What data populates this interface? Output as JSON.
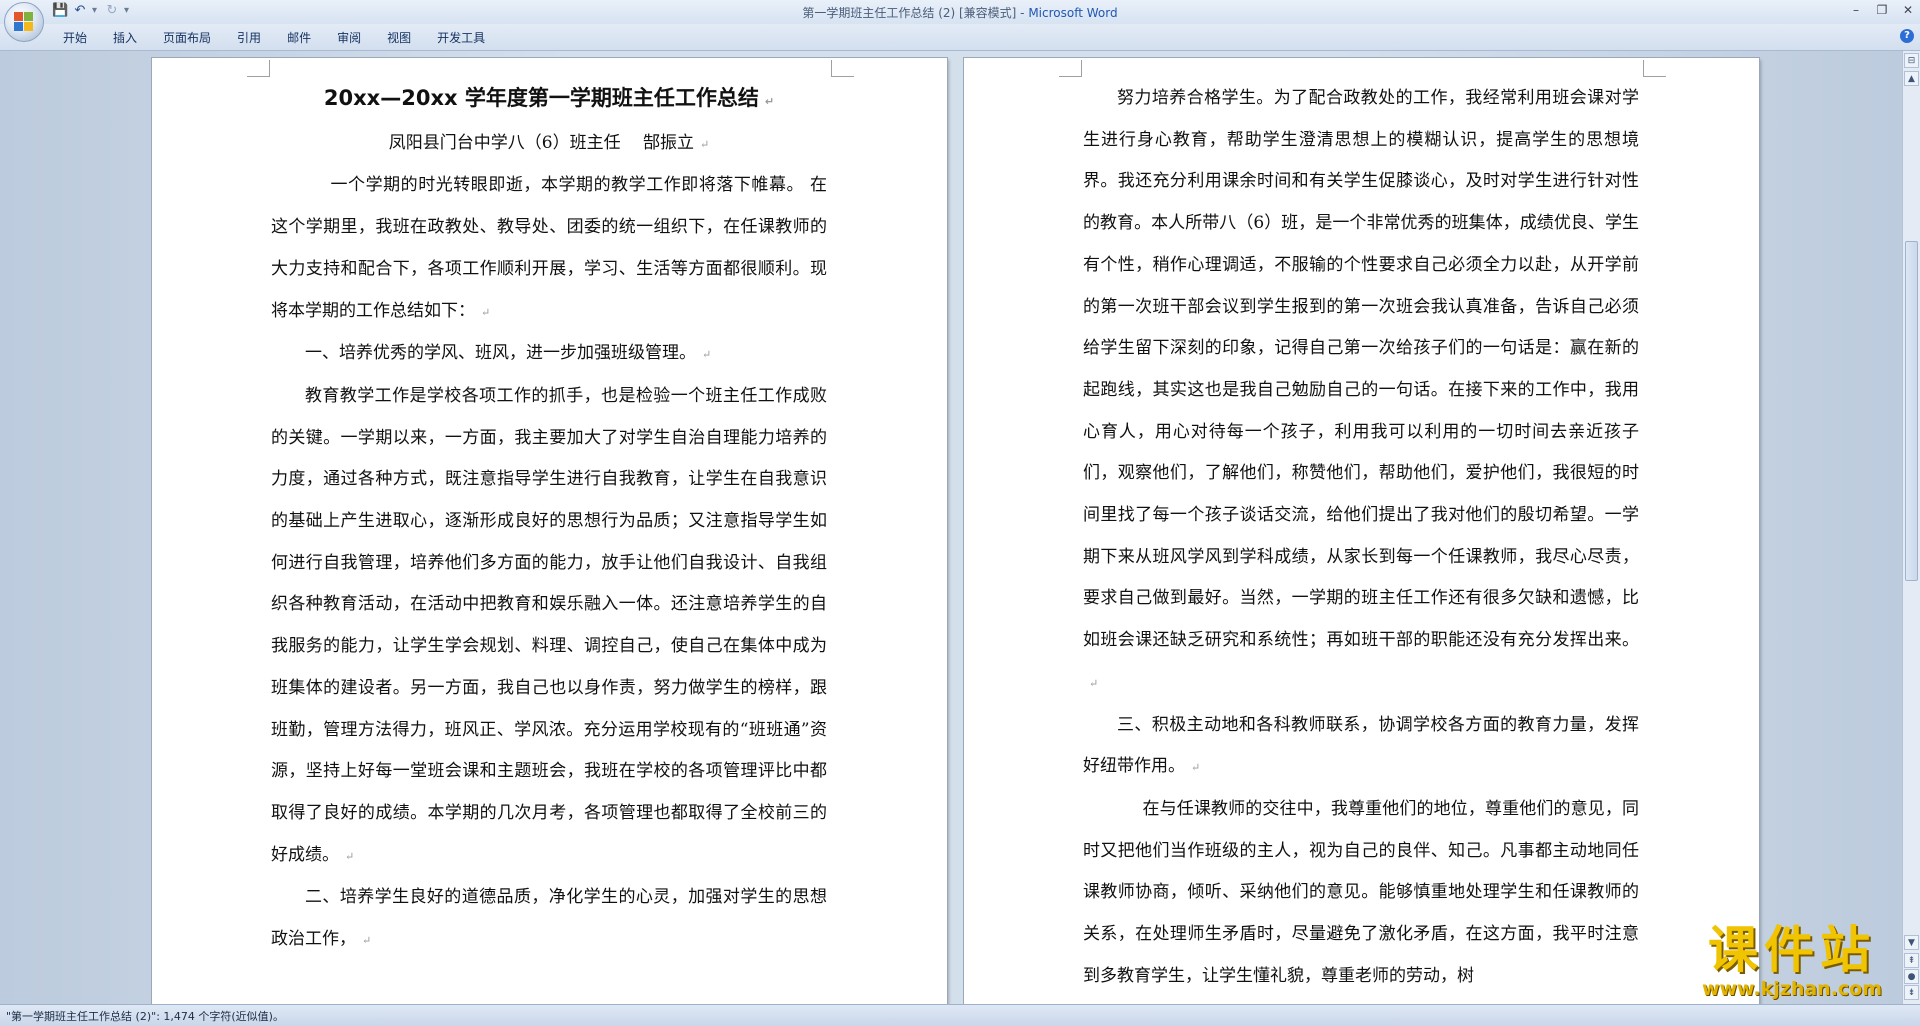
{
  "window": {
    "doc_name": "第一学期班主任工作总结 (2) [兼容模式] - ",
    "app_name": "Microsoft Word"
  },
  "quick_access": {
    "save_icon": "save-icon",
    "undo_icon": "undo-icon",
    "redo_icon": "redo-icon"
  },
  "ribbon_tabs": [
    "开始",
    "插入",
    "页面布局",
    "引用",
    "邮件",
    "审阅",
    "视图",
    "开发工具"
  ],
  "left_page": {
    "title": "20xx—20xx 学年度第一学期班主任工作总结",
    "subtitle": "凤阳县门台中学八（6）班主任　 郜振立",
    "p1": "一个学期的时光转眼即逝，本学期的教学工作即将落下帷幕。 在这个学期里，我班在政教处、教导处、团委的统一组织下，在任课教师的大力支持和配合下，各项工作顺利开展，学习、生活等方面都很顺利。现将本学期的工作总结如下：",
    "h1": "一、培养优秀的学风、班风，进一步加强班级管理。",
    "p2": "教育教学工作是学校各项工作的抓手，也是检验一个班主任工作成败的关键。一学期以来，一方面，我主要加大了对学生自治自理能力培养的力度，通过各种方式，既注意指导学生进行自我教育，让学生在自我意识的基础上产生进取心，逐渐形成良好的思想行为品质；又注意指导学生如何进行自我管理，培养他们多方面的能力，放手让他们自我设计、自我组织各种教育活动，在活动中把教育和娱乐融入一体。还注意培养学生的自我服务的能力，让学生学会规划、料理、调控自己，使自己在集体中成为班集体的建设者。另一方面，我自己也以身作责，努力做学生的榜样，跟班勤，管理方法得力，班风正、学风浓。充分运用学校现有的“班班通”资源，坚持上好每一堂班会课和主题班会，我班在学校的各项管理评比中都取得了良好的成绩。本学期的几次月考，各项管理也都取得了全校前三的好成绩。",
    "h2": "二、培养学生良好的道德品质，净化学生的心灵，加强对学生的思想政治工作，"
  },
  "right_page": {
    "p1": "努力培养合格学生。为了配合政教处的工作，我经常利用班会课对学生进行身心教育，帮助学生澄清思想上的模糊认识，提高学生的思想境界。我还充分利用课余时间和有关学生促膝谈心，及时对学生进行针对性的教育。本人所带八（6）班，是一个非常优秀的班集体，成绩优良、学生有个性，稍作心理调适，不服输的个性要求自己必须全力以赴，从开学前的第一次班干部会议到学生报到的第一次班会我认真准备，告诉自己必须给学生留下深刻的印象，记得自己第一次给孩子们的一句话是：赢在新的起跑线，其实这也是我自己勉励自己的一句话。在接下来的工作中，我用心育人，用心对待每一个孩子，利用我可以利用的一切时间去亲近孩子们，观察他们，了解他们，称赞他们，帮助他们，爱护他们，我很短的时间里找了每一个孩子谈话交流，给他们提出了我对他们的殷切希望。一学期下来从班风学风到学科成绩，从家长到每一个任课教师，我尽心尽责，要求自己做到最好。当然，一学期的班主任工作还有很多欠缺和遗憾，比如班会课还缺乏研究和系统性；再如班干部的职能还没有充分发挥出来。",
    "h3": "三、积极主动地和各科教师联系，协调学校各方面的教育力量，发挥好纽带作用。",
    "p2": "在与任课教师的交往中，我尊重他们的地位，尊重他们的意见，同时又把他们当作班级的主人，视为自己的良伴、知己。凡事都主动地同任课教师协商，倾听、采纳他们的意见。能够慎重地处理学生和任课教师的关系，在处理师生矛盾时，尽量避免了激化矛盾，在这方面，我平时注意到多教育学生，让学生懂礼貌，尊重老师的劳动，树"
  },
  "paragraph_mark": "↵",
  "status": {
    "text": "\"第一学期班主任工作总结 (2)\": 1,474 个字符(近似值)。"
  },
  "watermark": {
    "cn": "课件站",
    "url": "www.kjzhan.com"
  }
}
